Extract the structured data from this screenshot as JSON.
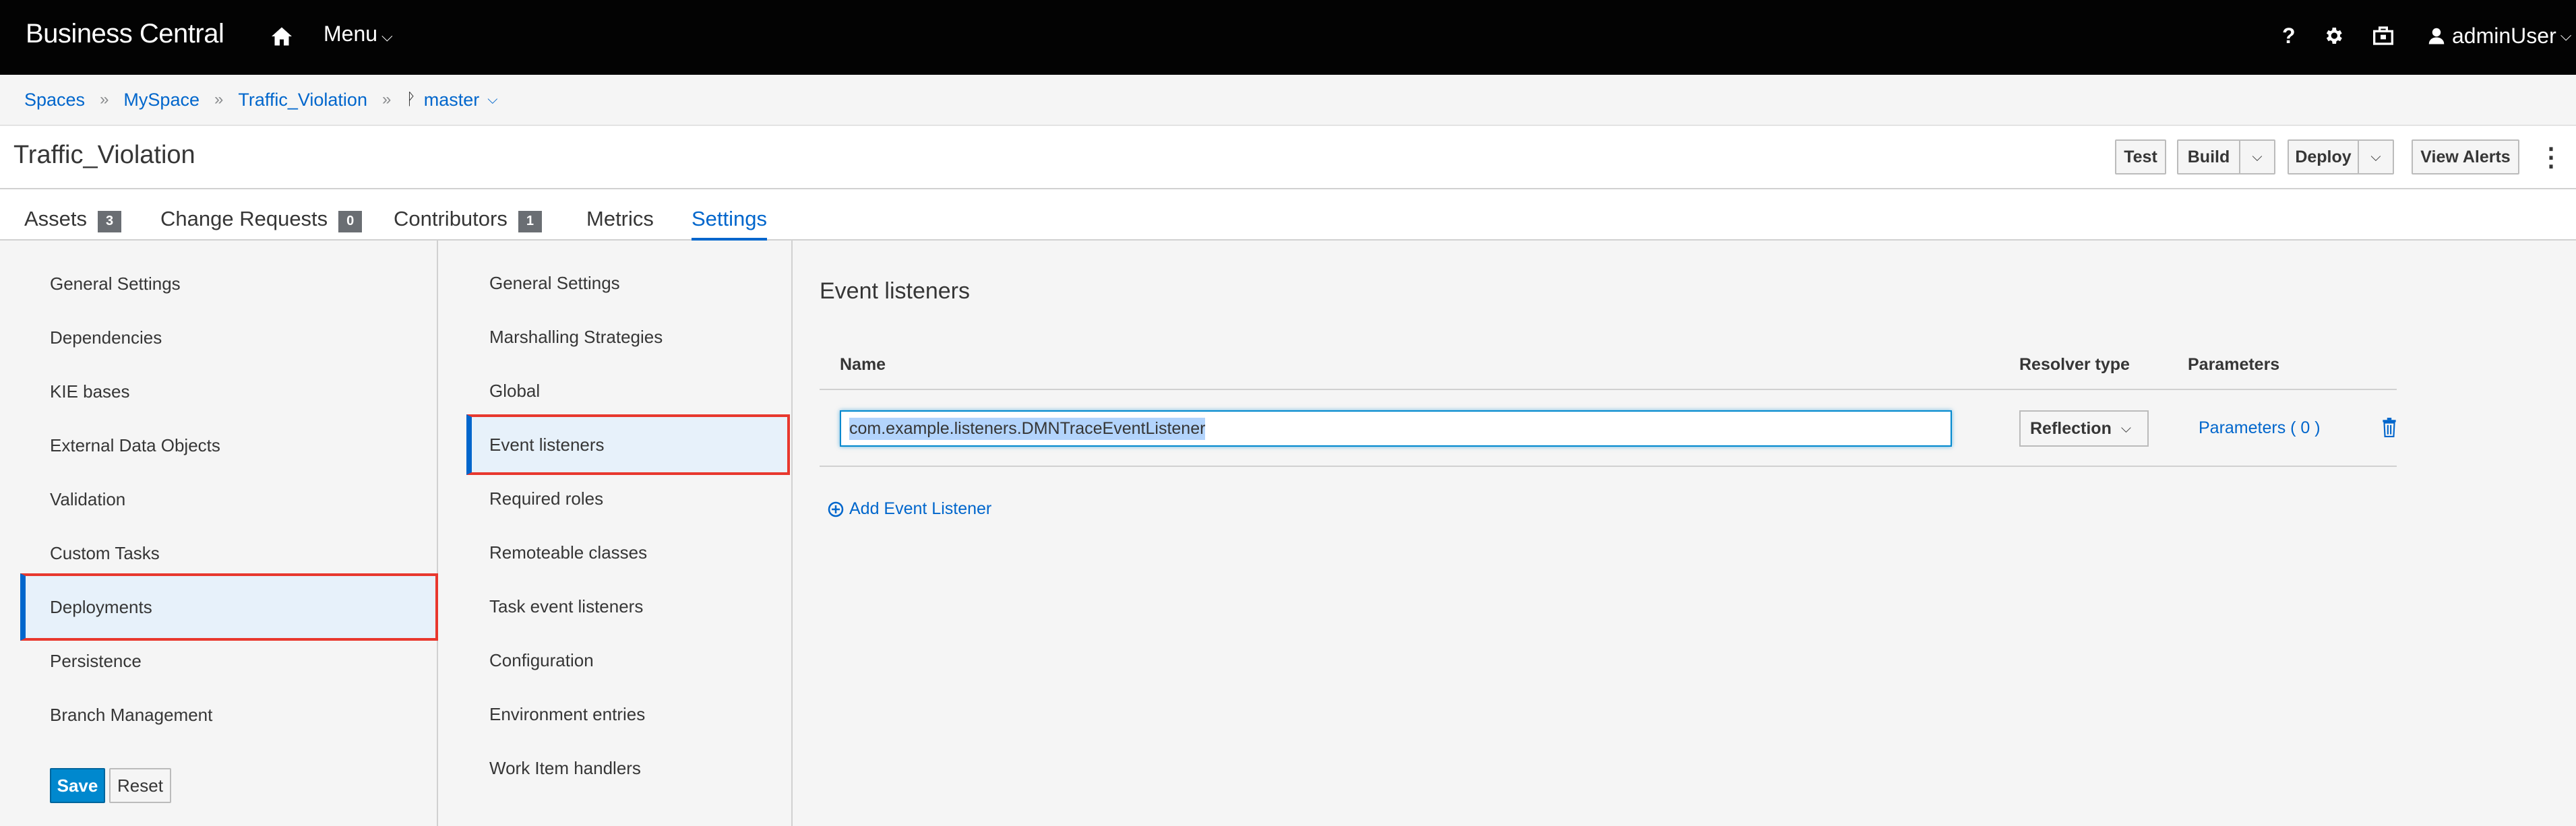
{
  "topbar": {
    "brand": "Business Central",
    "home_icon": "home-icon",
    "menu_label": "Menu",
    "help_label": "?",
    "user_label": "adminUser"
  },
  "breadcrumb": {
    "items": [
      "Spaces",
      "MySpace",
      "Traffic_Violation"
    ],
    "separator": "»",
    "branch": "master"
  },
  "project": {
    "title": "Traffic_Violation",
    "buttons": {
      "test": "Test",
      "build": "Build",
      "deploy": "Deploy",
      "view_alerts": "View Alerts"
    }
  },
  "tabs": [
    {
      "label": "Assets",
      "count": "3"
    },
    {
      "label": "Change Requests",
      "count": "0"
    },
    {
      "label": "Contributors",
      "count": "1"
    },
    {
      "label": "Metrics"
    },
    {
      "label": "Settings",
      "active": true
    }
  ],
  "settings_nav": {
    "items": [
      "General Settings",
      "Dependencies",
      "KIE bases",
      "External Data Objects",
      "Validation",
      "Custom Tasks",
      "Deployments",
      "Persistence",
      "Branch Management"
    ],
    "selected": "Deployments",
    "save_label": "Save",
    "reset_label": "Reset"
  },
  "deployments_nav": {
    "items": [
      "General Settings",
      "Marshalling Strategies",
      "Global",
      "Event listeners",
      "Required roles",
      "Remoteable classes",
      "Task event listeners",
      "Configuration",
      "Environment entries",
      "Work Item handlers"
    ],
    "selected": "Event listeners"
  },
  "event_listeners": {
    "title": "Event listeners",
    "columns": {
      "name": "Name",
      "resolver": "Resolver type",
      "params": "Parameters"
    },
    "rows": [
      {
        "name": "com.example.listeners.DMNTraceEventListener",
        "resolver": "Reflection",
        "params": "Parameters ( 0 )"
      }
    ],
    "add_label": "Add Event Listener"
  },
  "colors": {
    "accent": "#0066cc",
    "highlight_border": "#e8382e",
    "selected_bg": "#e7f1fa",
    "topbar_bg": "#030303"
  }
}
